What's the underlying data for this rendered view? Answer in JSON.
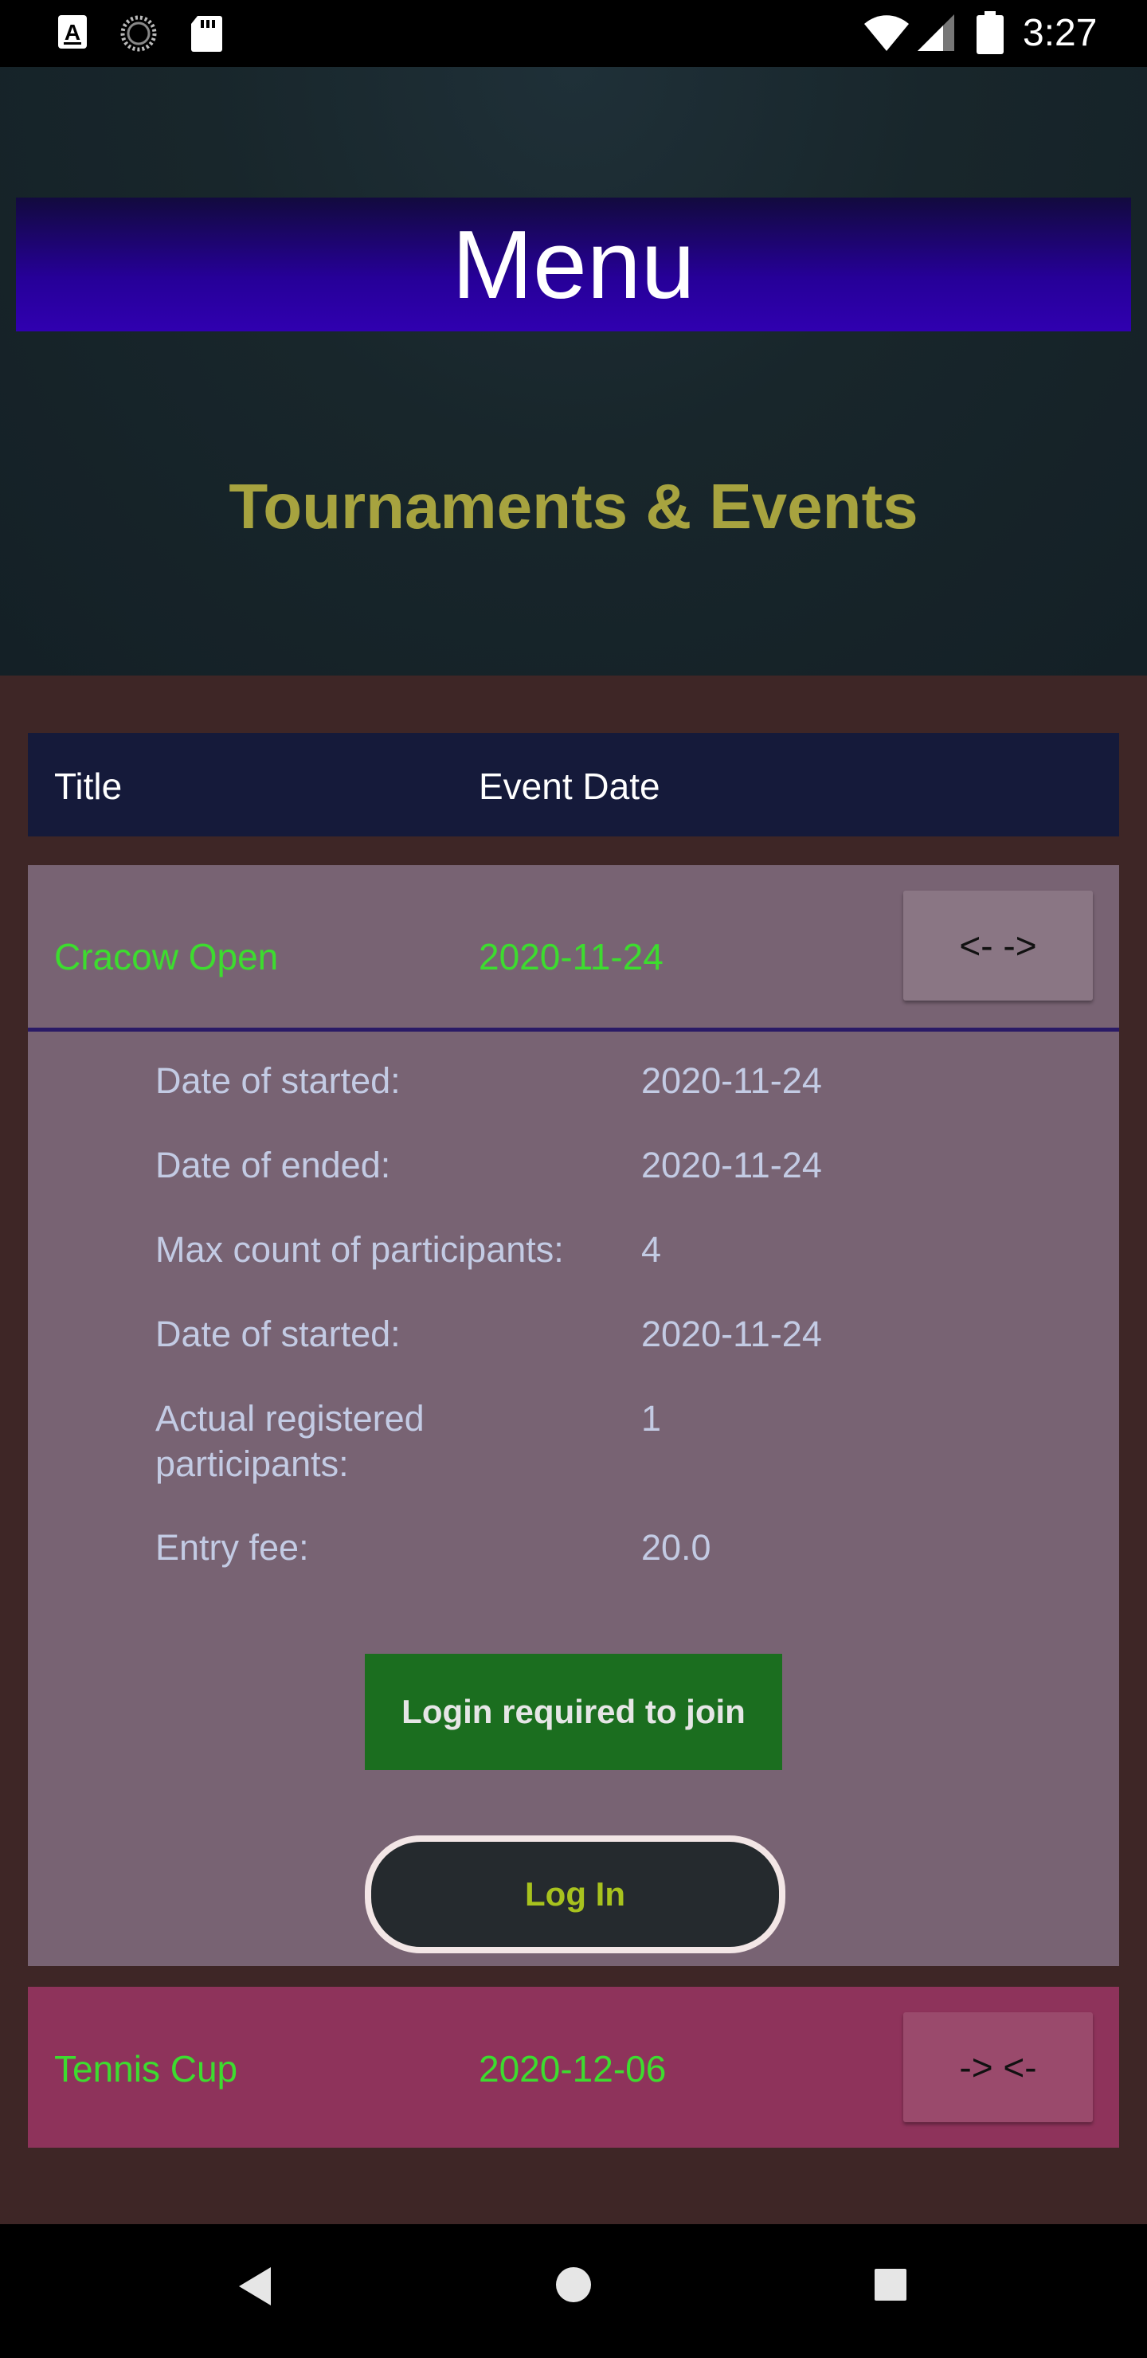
{
  "status_bar": {
    "time": "3:27",
    "icons": [
      "text-a-icon",
      "loading-spinner-icon",
      "sd-card-icon",
      "wifi-icon",
      "signal-icon",
      "battery-icon"
    ]
  },
  "header": {
    "menu_label": "Menu",
    "section_title": "Tournaments & Events"
  },
  "list": {
    "columns": {
      "title": "Title",
      "event_date": "Event Date"
    },
    "events": [
      {
        "title": "Cracow Open",
        "date": "2020-11-24",
        "toggle_label": "<- ->",
        "expanded": true,
        "details": [
          {
            "label": "Date of started:",
            "value": "2020-11-24"
          },
          {
            "label": "Date of ended:",
            "value": "2020-11-24"
          },
          {
            "label": "Max count of participants:",
            "value": "4"
          },
          {
            "label": "Date of started:",
            "value": "2020-11-24"
          },
          {
            "label": "Actual registered participants:",
            "value": "1"
          },
          {
            "label": "Entry fee:",
            "value": "20.0"
          }
        ],
        "join_button_label": "Login required to join",
        "login_button_label": "Log In"
      },
      {
        "title": "Tennis Cup",
        "date": "2020-12-06",
        "toggle_label": "-> <-",
        "expanded": false
      }
    ]
  },
  "colors": {
    "background": "#3e2626",
    "menu_bar": "#2600a0",
    "section_title": "#a7a33f",
    "list_header": "#151a3a",
    "card_open": "#786373",
    "card_closed": "#8e335b",
    "event_text": "#3ddc2f",
    "detail_text": "#c3cbe4",
    "join_button": "#1b6e1f",
    "login_text": "#a8c21e"
  },
  "nav_bar": {
    "icons": [
      "back-icon",
      "home-icon",
      "recents-icon"
    ]
  }
}
